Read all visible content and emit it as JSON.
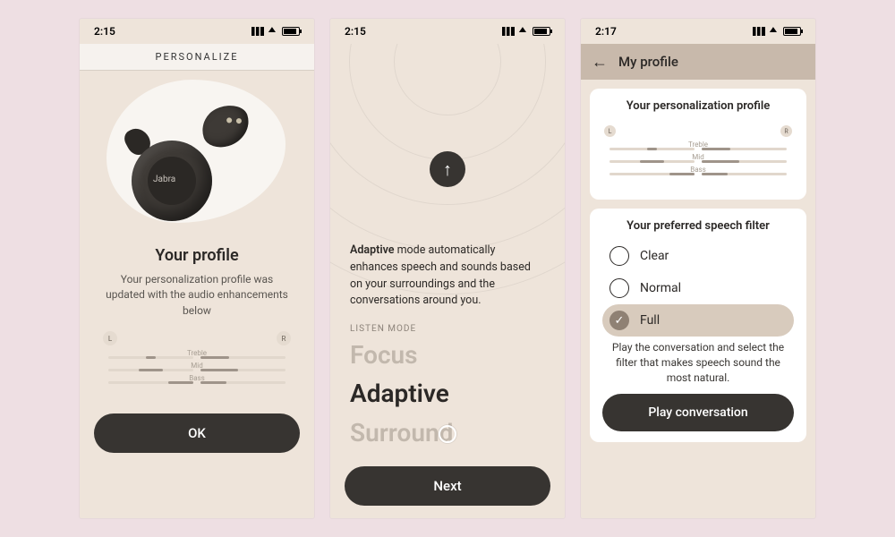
{
  "screen1": {
    "status_time": "2:15",
    "header": "PERSONALIZE",
    "brand": "Jabra",
    "title": "Your profile",
    "subtitle": "Your personalization profile was updated with the audio enhancements below",
    "eq": {
      "left_label": "L",
      "right_label": "R",
      "bands": {
        "treble": "Treble",
        "mid": "Mid",
        "bass": "Bass"
      }
    },
    "ok_label": "OK"
  },
  "screen2": {
    "status_time": "2:15",
    "description_bold": "Adaptive",
    "description_rest": " mode automatically enhances speech and sounds based on your surroundings and the conversations around you.",
    "listen_mode_label": "LISTEN MODE",
    "modes": {
      "focus": "Focus",
      "adaptive": "Adaptive",
      "surround": "Surround"
    },
    "next_label": "Next"
  },
  "screen3": {
    "status_time": "2:17",
    "header_title": "My profile",
    "card1_title": "Your personalization profile",
    "eq": {
      "left_label": "L",
      "right_label": "R",
      "bands": {
        "treble": "Treble",
        "mid": "Mid",
        "bass": "Bass"
      }
    },
    "card2_title": "Your preferred speech filter",
    "filters": {
      "clear": "Clear",
      "normal": "Normal",
      "full": "Full"
    },
    "help_text": "Play the conversation and select the filter that makes speech sound the most natural.",
    "play_label": "Play conversation"
  }
}
